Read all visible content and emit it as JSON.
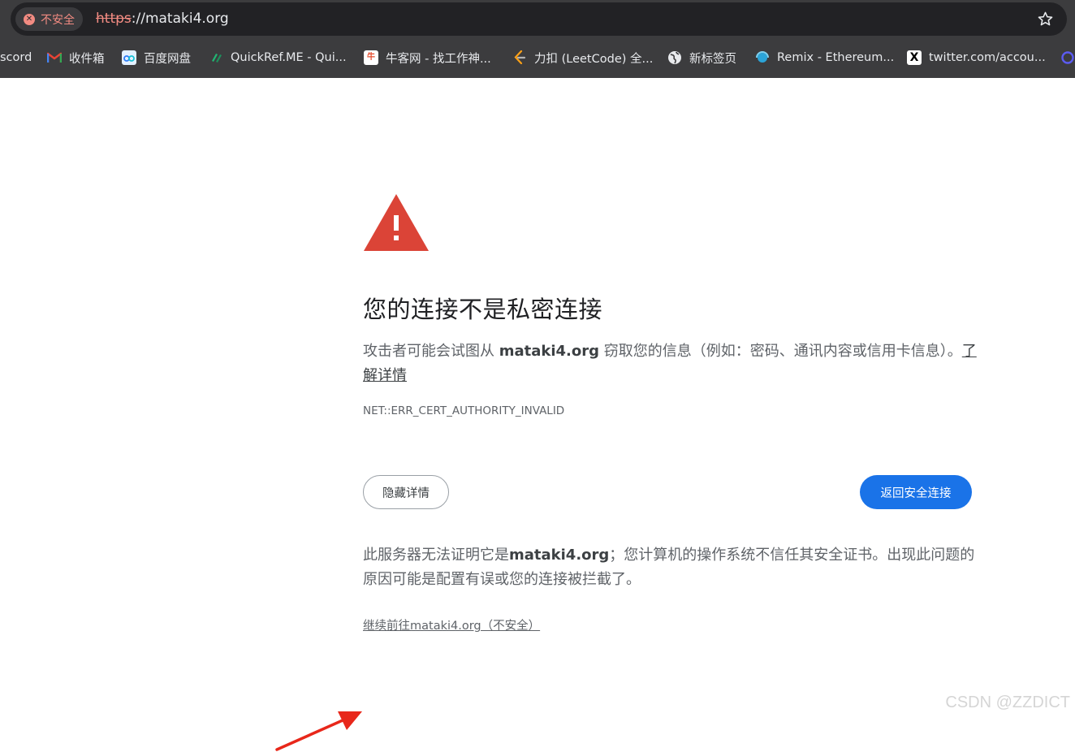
{
  "omnibox": {
    "security_label": "不安全",
    "url_scheme": "https",
    "url_rest": "://mataki4.org"
  },
  "bookmarks": [
    {
      "label": "scord",
      "icon": "discord-icon"
    },
    {
      "label": "收件箱",
      "icon": "gmail-icon"
    },
    {
      "label": "百度网盘",
      "icon": "baidu-netdisk-icon"
    },
    {
      "label": "QuickRef.ME - Qui...",
      "icon": "quickref-icon"
    },
    {
      "label": "牛客网 - 找工作神...",
      "icon": "nowcoder-icon"
    },
    {
      "label": "力扣 (LeetCode) 全...",
      "icon": "leetcode-icon"
    },
    {
      "label": "新标签页",
      "icon": "globe-icon"
    },
    {
      "label": "Remix - Ethereum...",
      "icon": "remix-icon"
    },
    {
      "label": "twitter.com/accou...",
      "icon": "x-icon"
    }
  ],
  "interstitial": {
    "heading": "您的连接不是私密连接",
    "message_prefix": "攻击者可能会试图从 ",
    "message_domain": "mataki4.org",
    "message_suffix": " 窃取您的信息（例如：密码、通讯内容或信用卡信息）。",
    "learn_more": "了解详情",
    "error_code": "NET::ERR_CERT_AUTHORITY_INVALID",
    "details_button": "隐藏详情",
    "back_button": "返回安全连接",
    "explanation_prefix": "此服务器无法证明它是",
    "explanation_domain": "mataki4.org",
    "explanation_suffix": "；您计算机的操作系统不信任其安全证书。出现此问题的原因可能是配置有误或您的连接被拦截了。",
    "proceed_link": "继续前往mataki4.org（不安全）"
  },
  "watermark": "CSDN @ZZDICT",
  "colors": {
    "danger_red": "#db4437",
    "primary_blue": "#1a73e8",
    "annotation_arrow": "#e8271a"
  }
}
